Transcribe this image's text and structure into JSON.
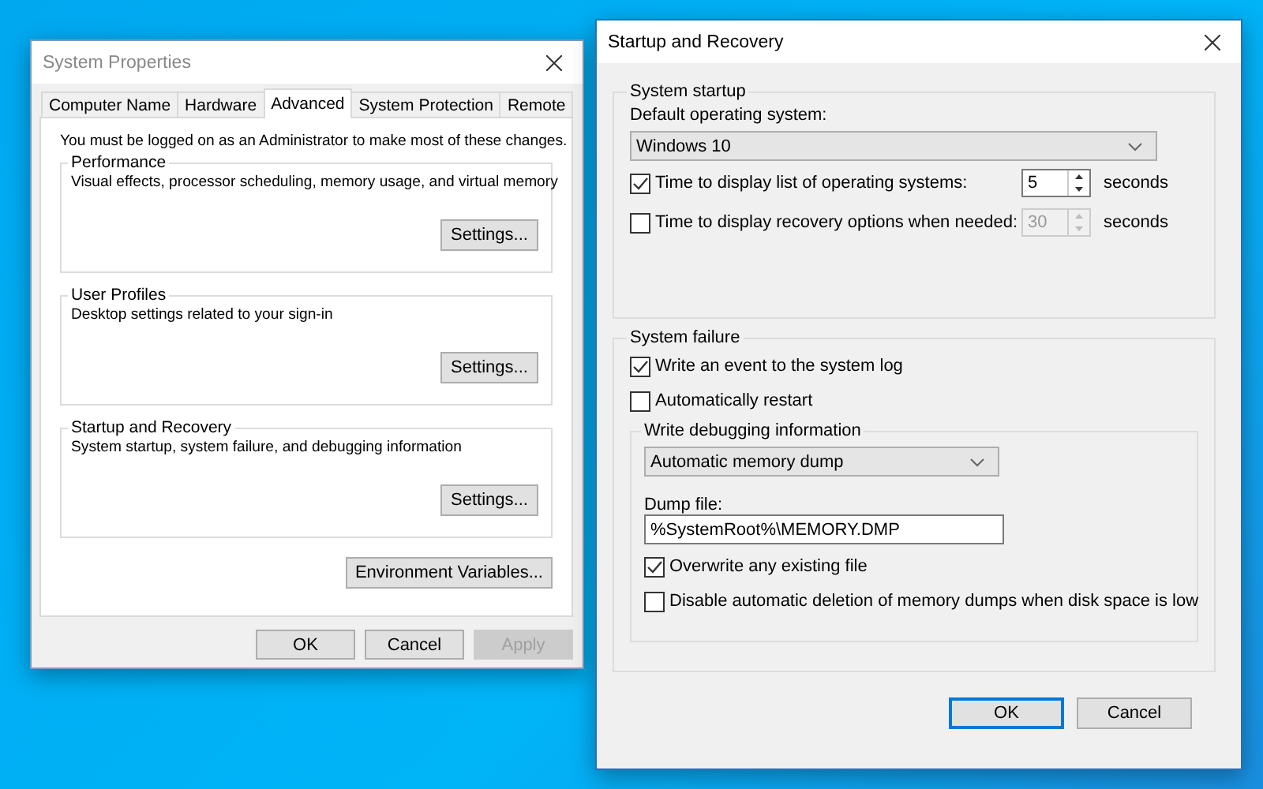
{
  "system_properties": {
    "title": "System Properties",
    "tabs": [
      {
        "label": "Computer Name",
        "selected": false
      },
      {
        "label": "Hardware",
        "selected": false
      },
      {
        "label": "Advanced",
        "selected": true
      },
      {
        "label": "System Protection",
        "selected": false
      },
      {
        "label": "Remote",
        "selected": false
      }
    ],
    "notice": "You must be logged on as an Administrator to make most of these changes.",
    "groups": [
      {
        "title": "Performance",
        "description": "Visual effects, processor scheduling, memory usage, and virtual memory",
        "button": "Settings..."
      },
      {
        "title": "User Profiles",
        "description": "Desktop settings related to your sign-in",
        "button": "Settings..."
      },
      {
        "title": "Startup and Recovery",
        "description": "System startup, system failure, and debugging information",
        "button": "Settings..."
      }
    ],
    "environment_button": "Environment Variables...",
    "buttons": [
      {
        "label": "OK",
        "disabled": false
      },
      {
        "label": "Cancel",
        "disabled": false
      },
      {
        "label": "Apply",
        "disabled": true
      }
    ]
  },
  "startup_recovery": {
    "title": "Startup and Recovery",
    "system_startup": {
      "title": "System startup",
      "default_os_label": "Default operating system:",
      "default_os": "Windows 10",
      "options": [
        {
          "label": "Time to display list of operating systems:",
          "checked": true,
          "value": "5",
          "disabled": false,
          "unit": "seconds"
        },
        {
          "label": "Time to display recovery options when needed:",
          "checked": false,
          "value": "30",
          "disabled": true,
          "unit": "seconds"
        }
      ]
    },
    "system_failure": {
      "title": "System failure",
      "options": [
        {
          "label": "Write an event to the system log",
          "checked": true
        },
        {
          "label": "Automatically restart",
          "checked": false
        }
      ],
      "debugging": {
        "title": "Write debugging information",
        "dump_type": "Automatic memory dump",
        "dump_file_label": "Dump file:",
        "dump_file": "%SystemRoot%\\MEMORY.DMP",
        "options": [
          {
            "label": "Overwrite any existing file",
            "checked": true
          },
          {
            "label": "Disable automatic deletion of memory dumps when disk space is low",
            "checked": false
          }
        ]
      }
    },
    "buttons": [
      {
        "label": "OK",
        "default": true
      },
      {
        "label": "Cancel",
        "default": false
      }
    ]
  }
}
